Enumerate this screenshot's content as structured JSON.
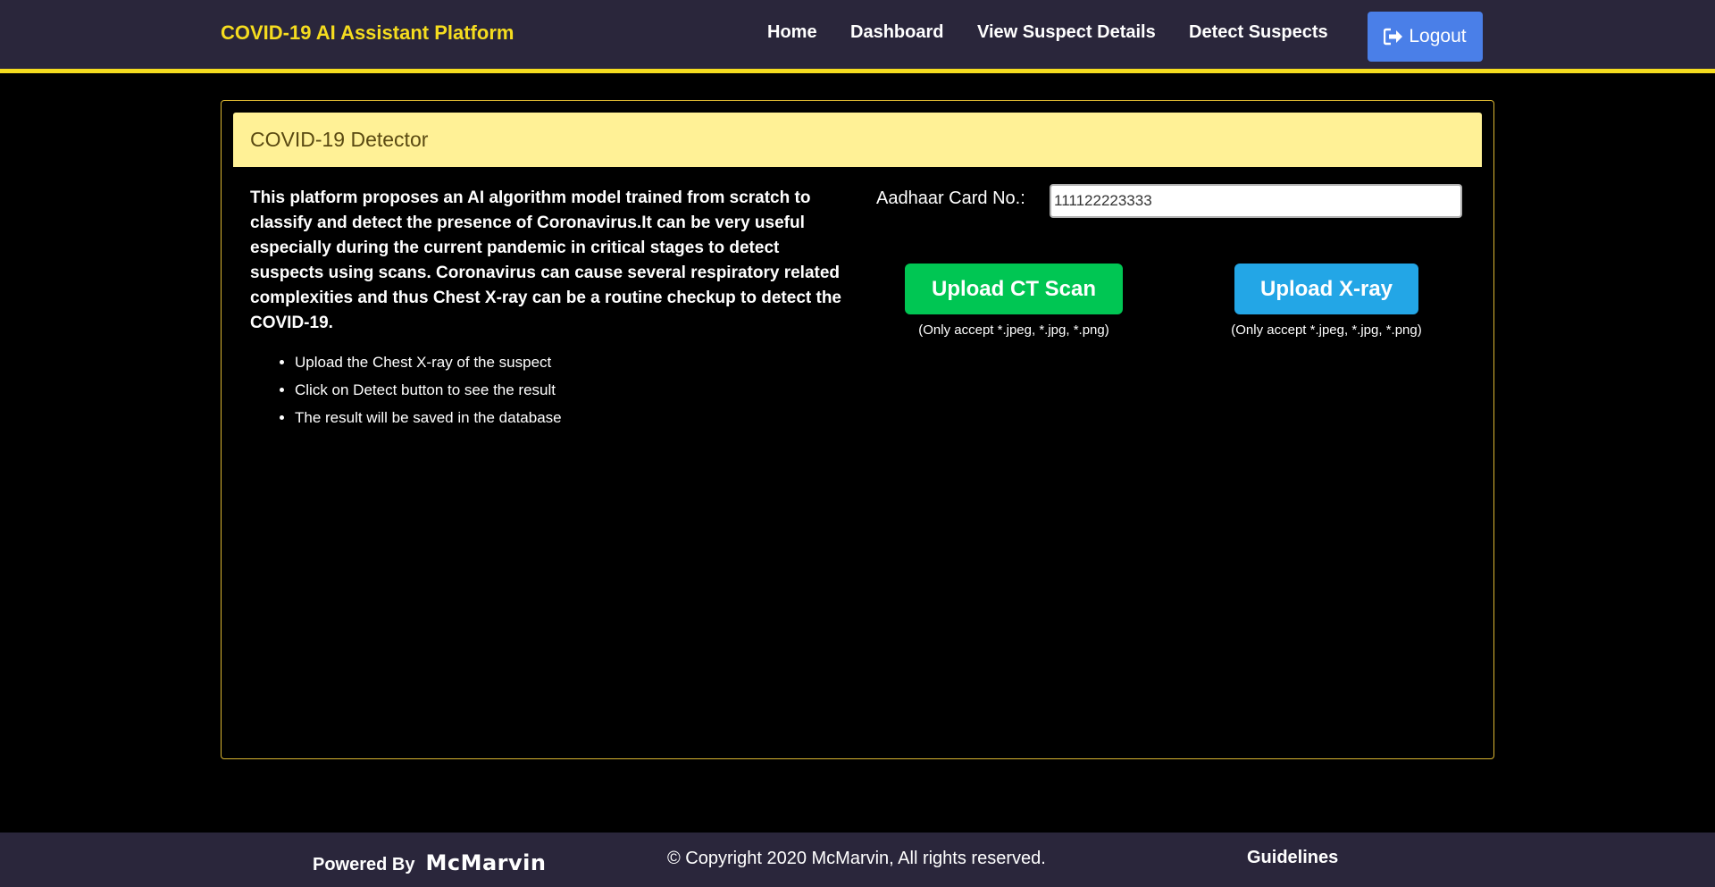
{
  "header": {
    "brand": "COVID-19 AI Assistant Platform",
    "nav": {
      "home": "Home",
      "dashboard": "Dashboard",
      "view_suspect_details": "View Suspect Details",
      "detect_suspects": "Detect Suspects"
    },
    "logout_label": "Logout",
    "logout_icon": "sign-out-icon"
  },
  "detector": {
    "title": "COVID-19 Detector",
    "intro": "This platform proposes an AI algorithm model trained from scratch to classify and detect the presence of Coronavirus.It can be very useful especially during the current pandemic in critical stages to detect suspects using scans. Coronavirus can cause several respiratory related complexities and thus Chest X-ray can be a routine checkup to detect the COVID-19.",
    "steps": [
      "Upload the Chest X-ray of the suspect",
      "Click on Detect button to see the result",
      "The result will be saved in the database"
    ],
    "aadhaar_label": "Aadhaar Card No.:",
    "aadhaar_value": "111122223333",
    "upload_ct_label": "Upload CT Scan",
    "upload_ct_note": "(Only accept *.jpeg, *.jpg, *.png)",
    "upload_xray_label": "Upload X-ray",
    "upload_xray_note": "(Only accept *.jpeg, *.jpg, *.png)"
  },
  "footer": {
    "powered_label": "Powered By",
    "powered_logo": "McMarvin",
    "copyright": "© Copyright 2020 McMarvin, All rights reserved.",
    "guidelines": "Guidelines"
  },
  "colors": {
    "header_bg": "#2a263b",
    "accent_yellow": "#f5dc1f",
    "card_header_bg": "#fff196",
    "logout_blue": "#4a7fe8",
    "ct_green": "#00c653",
    "xray_blue": "#23a6e6"
  }
}
